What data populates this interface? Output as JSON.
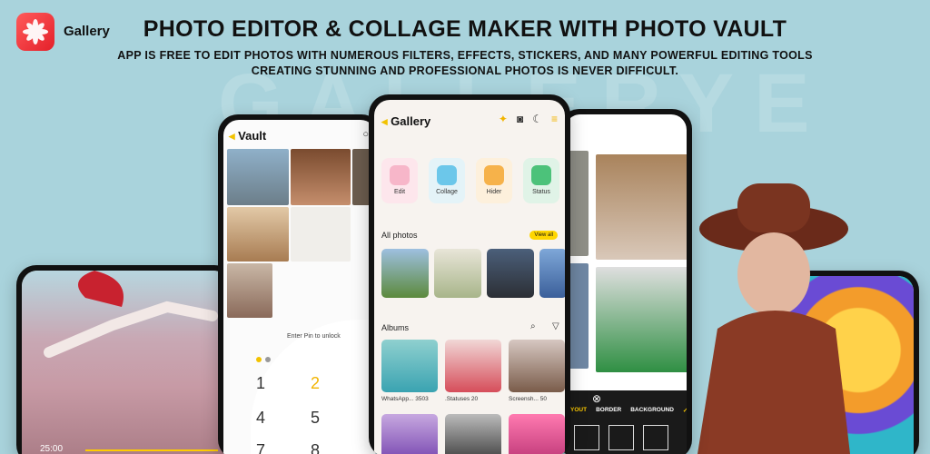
{
  "brand": {
    "name": "Gallery"
  },
  "header": {
    "headline": "PHOTO EDITOR & COLLAGE MAKER WITH PHOTO VAULT",
    "subline1": "APP IS FREE TO EDIT PHOTOS WITH NUMEROUS FILTERS, EFFECTS, STICKERS, AND MANY POWERFUL EDITING TOOLS",
    "subline2": "CREATING STUNNING AND PROFESSIONAL PHOTOS IS NEVER DIFFICULT."
  },
  "watermark": "GALLERYE",
  "video": {
    "time": "25:00"
  },
  "vault": {
    "title": "Vault",
    "pin_prompt": "Enter Pin to unlock",
    "keys": [
      "1",
      "2",
      "4",
      "5",
      "7",
      "8"
    ]
  },
  "gallery": {
    "title": "Gallery",
    "features": [
      {
        "label": "Edit",
        "color": "#f7b6c9",
        "bg": "#fde6ec"
      },
      {
        "label": "Collage",
        "color": "#6cc7ea",
        "bg": "#e4f3f8"
      },
      {
        "label": "Hider",
        "color": "#f6b24a",
        "bg": "#fdf0dc"
      },
      {
        "label": "Status",
        "color": "#4cc27a",
        "bg": "#e0f3e7"
      }
    ],
    "all_photos_label": "All photos",
    "view_all_label": "View all",
    "albums_label": "Albums",
    "albums": [
      {
        "name": "WhatsApp...",
        "count": "3503"
      },
      {
        "name": ".Statuses",
        "count": "20"
      },
      {
        "name": "Screensh...",
        "count": "50"
      }
    ]
  },
  "collage": {
    "tabs": [
      "YOUT",
      "BORDER",
      "BACKGROUND"
    ]
  },
  "colors": {
    "accent": "#ffcc00",
    "background": "#a9d3dc"
  }
}
